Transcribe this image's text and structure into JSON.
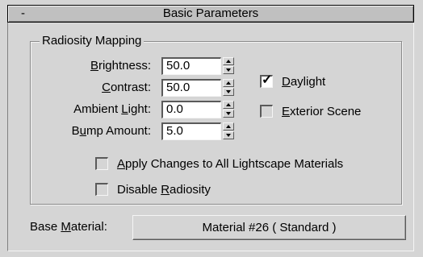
{
  "rollout": {
    "collapse_symbol": "-",
    "title": "Basic Parameters"
  },
  "radiosity_mapping": {
    "group_title": "Radiosity Mapping",
    "fields": [
      {
        "label_pre": "",
        "label_key": "B",
        "label_post": "rightness:",
        "value": "50.0"
      },
      {
        "label_pre": "",
        "label_key": "C",
        "label_post": "ontrast:",
        "value": "50.0"
      },
      {
        "label_pre": "Ambient ",
        "label_key": "L",
        "label_post": "ight:",
        "value": "0.0"
      },
      {
        "label_pre": "B",
        "label_key": "u",
        "label_post": "mp Amount:",
        "value": "5.0"
      }
    ],
    "daylight": {
      "label_key": "D",
      "label_post": "aylight",
      "checked": true,
      "mark": "✓"
    },
    "exterior_scene": {
      "label_key": "E",
      "label_post": "xterior Scene",
      "checked": false
    },
    "apply_changes": {
      "label_key": "A",
      "label_post": "pply Changes to All Lightscape Materials",
      "checked": false
    },
    "disable_radiosity": {
      "label_pre": "Disable ",
      "label_key": "R",
      "label_post": "adiosity",
      "checked": false
    }
  },
  "base_material": {
    "label_pre": "Base ",
    "label_key": "M",
    "label_post": "aterial:",
    "button_label": "Material #26  ( Standard )"
  }
}
